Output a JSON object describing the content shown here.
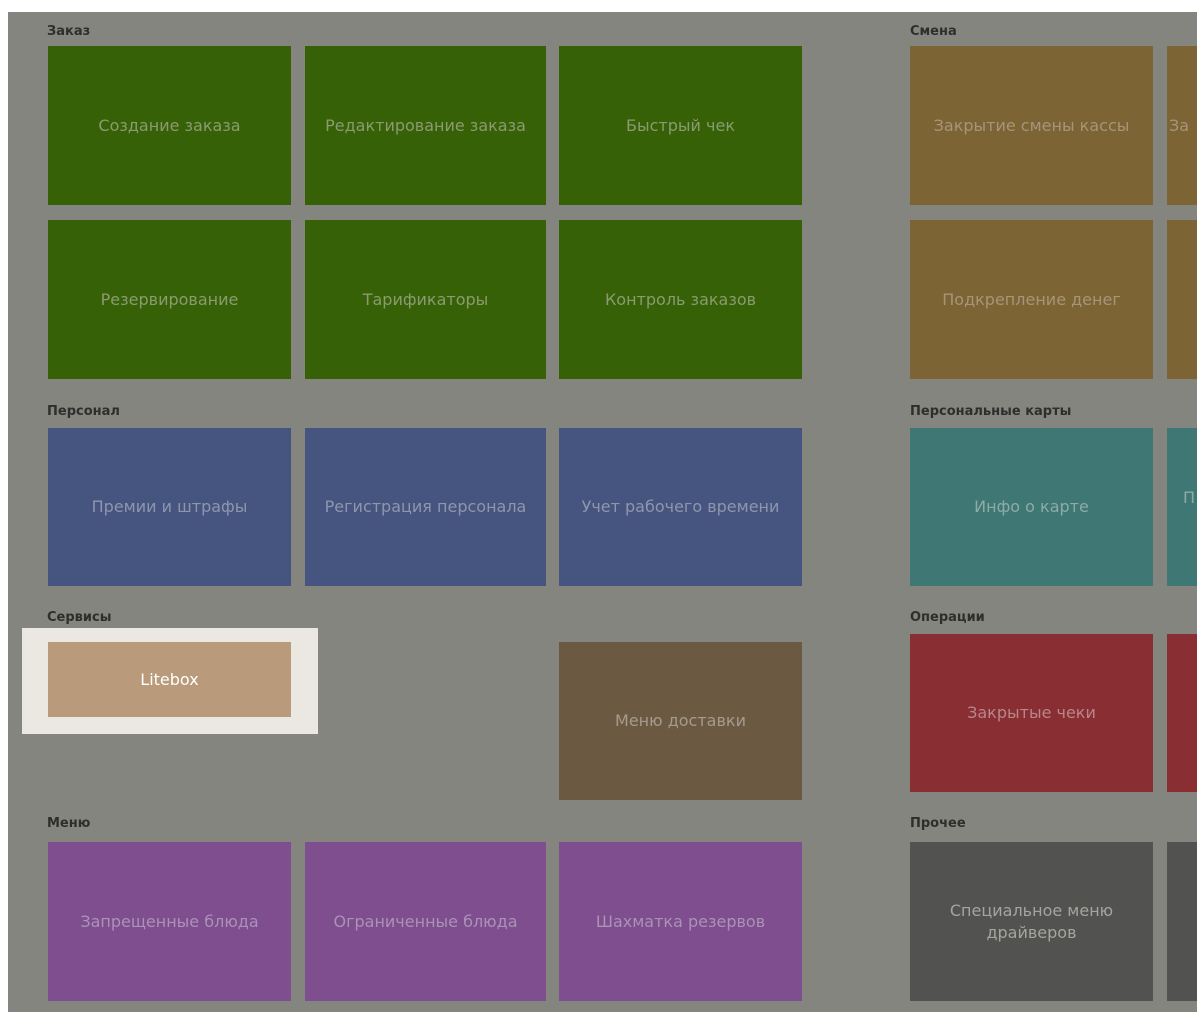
{
  "sections": {
    "order": "Заказ",
    "shift": "Смена",
    "personnel": "Персонал",
    "cards": "Персональные карты",
    "services": "Сервисы",
    "operations": "Операции",
    "menu": "Меню",
    "other": "Прочее"
  },
  "tiles": {
    "create_order": "Создание заказа",
    "edit_order": "Редактирование заказа",
    "quick_check": "Быстрый чек",
    "close_shift": "Закрытие смены кассы",
    "close_shift_2": "За",
    "reservation": "Резервирование",
    "tariffs": "Тарификаторы",
    "order_control": "Контроль заказов",
    "cash_reinforce": "Подкрепление денег",
    "bonuses": "Премии и штрафы",
    "staff_registration": "Регистрация персонала",
    "work_time": "Учет рабочего времени",
    "card_info": "Инфо о карте",
    "card_2": "П",
    "litebox": "Litebox",
    "delivery_menu": "Меню доставки",
    "closed_checks": "Закрытые чеки",
    "forbidden_dishes": "Запрещенные блюда",
    "limited_dishes": "Ограниченные блюда",
    "reservation_grid": "Шахматка резервов",
    "special_driver_menu": "Специальное меню драйверов"
  },
  "colors": {
    "background": "#858580",
    "green": "#376106",
    "gold": "#7c6434",
    "blue": "#46557f",
    "teal": "#3f7774",
    "red": "#892e33",
    "brown": "#6b5942",
    "purple": "#7e4e8e",
    "gray": "#525250",
    "litebox_highlight": "#ebe8e1",
    "litebox_tile": "#b99b7b"
  }
}
